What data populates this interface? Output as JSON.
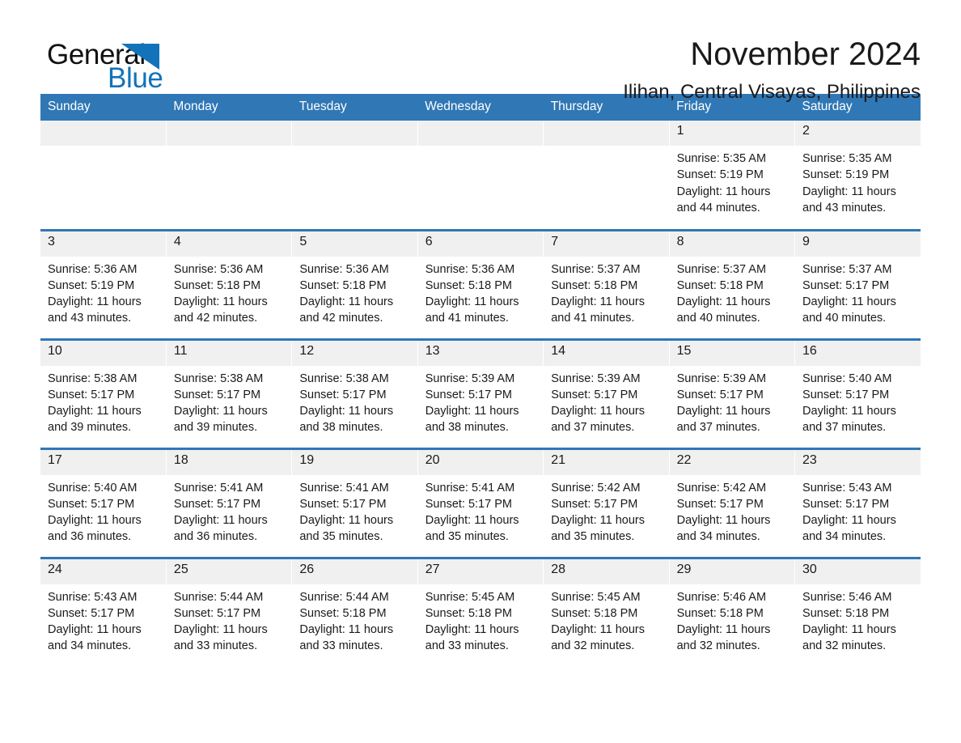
{
  "brand": {
    "name_part1": "General",
    "name_part2": "Blue",
    "accent_color": "#1273ba",
    "logo_icon": "triangle-flag-icon"
  },
  "header": {
    "title": "November 2024",
    "subtitle": "Ilihan, Central Visayas, Philippines",
    "header_bg_color": "#3077b5",
    "daynum_bg_color": "#f0f0f0"
  },
  "weekdays": [
    "Sunday",
    "Monday",
    "Tuesday",
    "Wednesday",
    "Thursday",
    "Friday",
    "Saturday"
  ],
  "labels": {
    "sunrise_prefix": "Sunrise:",
    "sunset_prefix": "Sunset:",
    "daylight_prefix": "Daylight:"
  },
  "weeks": [
    [
      {
        "day": "",
        "empty": true
      },
      {
        "day": "",
        "empty": true
      },
      {
        "day": "",
        "empty": true
      },
      {
        "day": "",
        "empty": true
      },
      {
        "day": "",
        "empty": true
      },
      {
        "day": "1",
        "sunrise": "Sunrise: 5:35 AM",
        "sunset": "Sunset: 5:19 PM",
        "daylight": "Daylight: 11 hours and 44 minutes."
      },
      {
        "day": "2",
        "sunrise": "Sunrise: 5:35 AM",
        "sunset": "Sunset: 5:19 PM",
        "daylight": "Daylight: 11 hours and 43 minutes."
      }
    ],
    [
      {
        "day": "3",
        "sunrise": "Sunrise: 5:36 AM",
        "sunset": "Sunset: 5:19 PM",
        "daylight": "Daylight: 11 hours and 43 minutes."
      },
      {
        "day": "4",
        "sunrise": "Sunrise: 5:36 AM",
        "sunset": "Sunset: 5:18 PM",
        "daylight": "Daylight: 11 hours and 42 minutes."
      },
      {
        "day": "5",
        "sunrise": "Sunrise: 5:36 AM",
        "sunset": "Sunset: 5:18 PM",
        "daylight": "Daylight: 11 hours and 42 minutes."
      },
      {
        "day": "6",
        "sunrise": "Sunrise: 5:36 AM",
        "sunset": "Sunset: 5:18 PM",
        "daylight": "Daylight: 11 hours and 41 minutes."
      },
      {
        "day": "7",
        "sunrise": "Sunrise: 5:37 AM",
        "sunset": "Sunset: 5:18 PM",
        "daylight": "Daylight: 11 hours and 41 minutes."
      },
      {
        "day": "8",
        "sunrise": "Sunrise: 5:37 AM",
        "sunset": "Sunset: 5:18 PM",
        "daylight": "Daylight: 11 hours and 40 minutes."
      },
      {
        "day": "9",
        "sunrise": "Sunrise: 5:37 AM",
        "sunset": "Sunset: 5:17 PM",
        "daylight": "Daylight: 11 hours and 40 minutes."
      }
    ],
    [
      {
        "day": "10",
        "sunrise": "Sunrise: 5:38 AM",
        "sunset": "Sunset: 5:17 PM",
        "daylight": "Daylight: 11 hours and 39 minutes."
      },
      {
        "day": "11",
        "sunrise": "Sunrise: 5:38 AM",
        "sunset": "Sunset: 5:17 PM",
        "daylight": "Daylight: 11 hours and 39 minutes."
      },
      {
        "day": "12",
        "sunrise": "Sunrise: 5:38 AM",
        "sunset": "Sunset: 5:17 PM",
        "daylight": "Daylight: 11 hours and 38 minutes."
      },
      {
        "day": "13",
        "sunrise": "Sunrise: 5:39 AM",
        "sunset": "Sunset: 5:17 PM",
        "daylight": "Daylight: 11 hours and 38 minutes."
      },
      {
        "day": "14",
        "sunrise": "Sunrise: 5:39 AM",
        "sunset": "Sunset: 5:17 PM",
        "daylight": "Daylight: 11 hours and 37 minutes."
      },
      {
        "day": "15",
        "sunrise": "Sunrise: 5:39 AM",
        "sunset": "Sunset: 5:17 PM",
        "daylight": "Daylight: 11 hours and 37 minutes."
      },
      {
        "day": "16",
        "sunrise": "Sunrise: 5:40 AM",
        "sunset": "Sunset: 5:17 PM",
        "daylight": "Daylight: 11 hours and 37 minutes."
      }
    ],
    [
      {
        "day": "17",
        "sunrise": "Sunrise: 5:40 AM",
        "sunset": "Sunset: 5:17 PM",
        "daylight": "Daylight: 11 hours and 36 minutes."
      },
      {
        "day": "18",
        "sunrise": "Sunrise: 5:41 AM",
        "sunset": "Sunset: 5:17 PM",
        "daylight": "Daylight: 11 hours and 36 minutes."
      },
      {
        "day": "19",
        "sunrise": "Sunrise: 5:41 AM",
        "sunset": "Sunset: 5:17 PM",
        "daylight": "Daylight: 11 hours and 35 minutes."
      },
      {
        "day": "20",
        "sunrise": "Sunrise: 5:41 AM",
        "sunset": "Sunset: 5:17 PM",
        "daylight": "Daylight: 11 hours and 35 minutes."
      },
      {
        "day": "21",
        "sunrise": "Sunrise: 5:42 AM",
        "sunset": "Sunset: 5:17 PM",
        "daylight": "Daylight: 11 hours and 35 minutes."
      },
      {
        "day": "22",
        "sunrise": "Sunrise: 5:42 AM",
        "sunset": "Sunset: 5:17 PM",
        "daylight": "Daylight: 11 hours and 34 minutes."
      },
      {
        "day": "23",
        "sunrise": "Sunrise: 5:43 AM",
        "sunset": "Sunset: 5:17 PM",
        "daylight": "Daylight: 11 hours and 34 minutes."
      }
    ],
    [
      {
        "day": "24",
        "sunrise": "Sunrise: 5:43 AM",
        "sunset": "Sunset: 5:17 PM",
        "daylight": "Daylight: 11 hours and 34 minutes."
      },
      {
        "day": "25",
        "sunrise": "Sunrise: 5:44 AM",
        "sunset": "Sunset: 5:17 PM",
        "daylight": "Daylight: 11 hours and 33 minutes."
      },
      {
        "day": "26",
        "sunrise": "Sunrise: 5:44 AM",
        "sunset": "Sunset: 5:18 PM",
        "daylight": "Daylight: 11 hours and 33 minutes."
      },
      {
        "day": "27",
        "sunrise": "Sunrise: 5:45 AM",
        "sunset": "Sunset: 5:18 PM",
        "daylight": "Daylight: 11 hours and 33 minutes."
      },
      {
        "day": "28",
        "sunrise": "Sunrise: 5:45 AM",
        "sunset": "Sunset: 5:18 PM",
        "daylight": "Daylight: 11 hours and 32 minutes."
      },
      {
        "day": "29",
        "sunrise": "Sunrise: 5:46 AM",
        "sunset": "Sunset: 5:18 PM",
        "daylight": "Daylight: 11 hours and 32 minutes."
      },
      {
        "day": "30",
        "sunrise": "Sunrise: 5:46 AM",
        "sunset": "Sunset: 5:18 PM",
        "daylight": "Daylight: 11 hours and 32 minutes."
      }
    ]
  ]
}
